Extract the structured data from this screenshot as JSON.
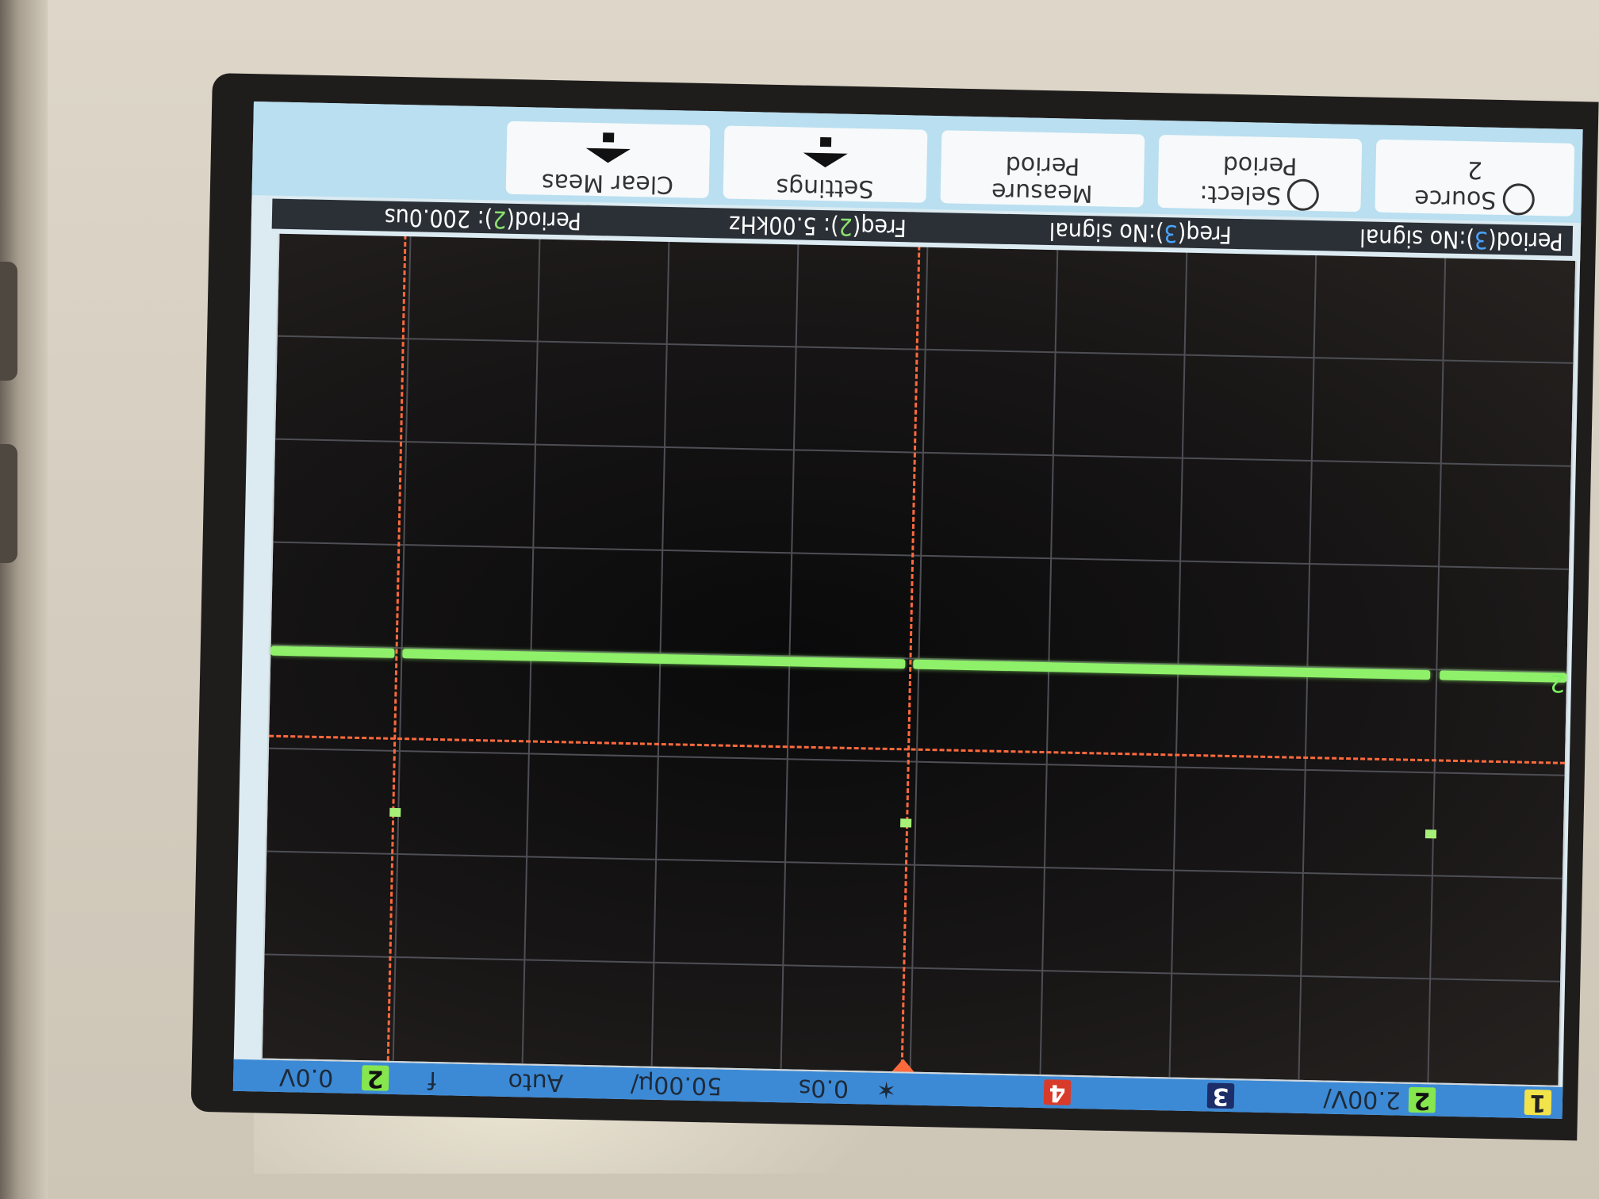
{
  "device": "oscilloscope",
  "orientation": "rotated-180",
  "softkeys": [
    {
      "line1": "Source",
      "line2": "2",
      "icon": "cycle-icon"
    },
    {
      "line1": "Select:",
      "line2": "Period",
      "icon": "cycle-icon"
    },
    {
      "line1": "Measure",
      "line2": "Period",
      "icon": ""
    },
    {
      "line1": "Settings",
      "line2": "",
      "icon": "arrow-up-icon"
    },
    {
      "line1": "Clear Meas",
      "line2": "",
      "icon": "arrow-up-icon"
    }
  ],
  "measurements": [
    {
      "prefix": "Period(",
      "channel": "3",
      "suffix": "):No signal"
    },
    {
      "prefix": "Freq(",
      "channel": "3",
      "suffix": "):No signal"
    },
    {
      "prefix": "Freq(",
      "channel": "2",
      "suffix": "): 5.00kHz"
    },
    {
      "prefix": "Period(",
      "channel": "2",
      "suffix": "): 200.0us"
    }
  ],
  "status": {
    "ch1": "1",
    "ch2": "2",
    "ch2_scale": "2.00V/",
    "ch3": "3",
    "ch4": "4",
    "delay": "0.0s",
    "timebase": "50.00µ/",
    "trigger_mode": "Auto",
    "trigger_slope": "f",
    "trigger_source": "2",
    "trigger_level": "0.0V"
  },
  "channel_marker": "2",
  "colors": {
    "trace": "#8ff06a",
    "cursor": "#ff6a3d",
    "statusbar": "#3c8ad6",
    "ch3": "#4aa3ff"
  }
}
